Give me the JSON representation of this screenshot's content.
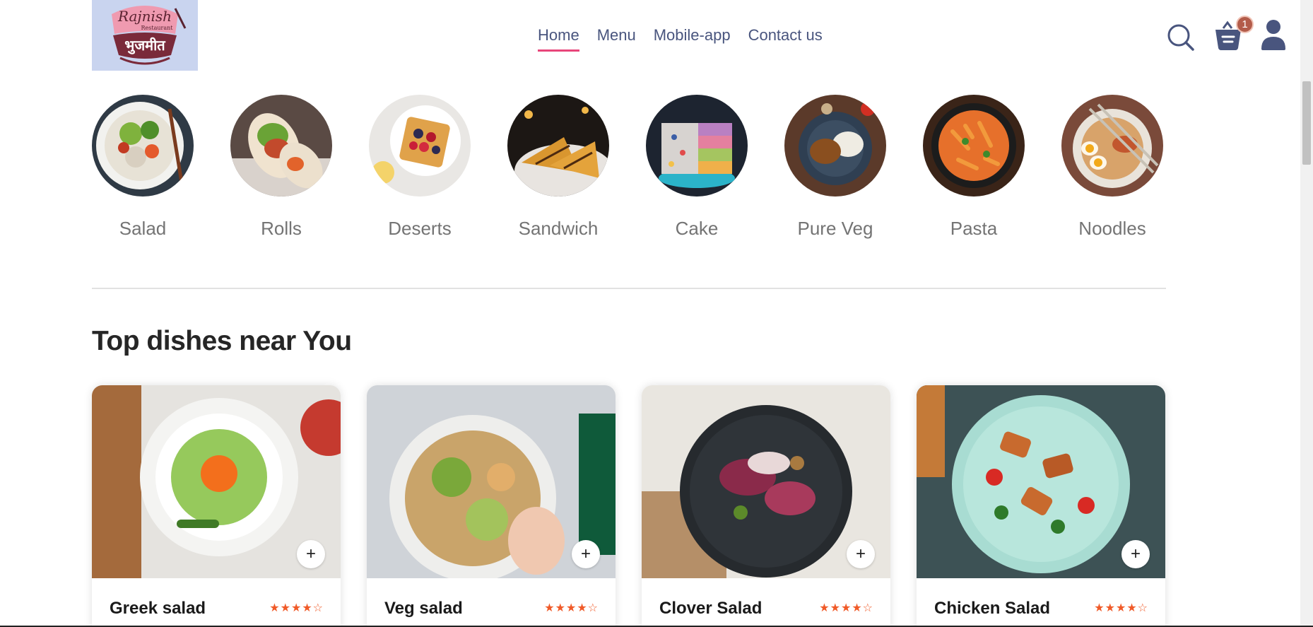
{
  "logo": {
    "name": "Rajnish",
    "sub": "Restaurant",
    "native": "भुजमीत"
  },
  "nav": {
    "items": [
      "Home",
      "Menu",
      "Mobile-app",
      "Contact us"
    ],
    "active": "Home",
    "accent": "#e8457a"
  },
  "header": {
    "search_icon": "search-icon",
    "basket_icon": "basket-icon",
    "basket_count": "1",
    "profile_icon": "profile-icon"
  },
  "categories": [
    {
      "label": "Salad"
    },
    {
      "label": "Rolls"
    },
    {
      "label": "Deserts"
    },
    {
      "label": "Sandwich"
    },
    {
      "label": "Cake"
    },
    {
      "label": "Pure Veg"
    },
    {
      "label": "Pasta"
    },
    {
      "label": "Noodles"
    }
  ],
  "section": {
    "title": "Top dishes near You"
  },
  "dishes": [
    {
      "name": "Greek salad",
      "rating": 4,
      "add": "+"
    },
    {
      "name": "Veg salad",
      "rating": 4,
      "add": "+"
    },
    {
      "name": "Clover Salad",
      "rating": 4,
      "add": "+"
    },
    {
      "name": "Chicken Salad",
      "rating": 4,
      "add": "+"
    }
  ],
  "colors": {
    "star": "#f05a28",
    "text": "#49557e",
    "badge": "#b35c4a"
  }
}
